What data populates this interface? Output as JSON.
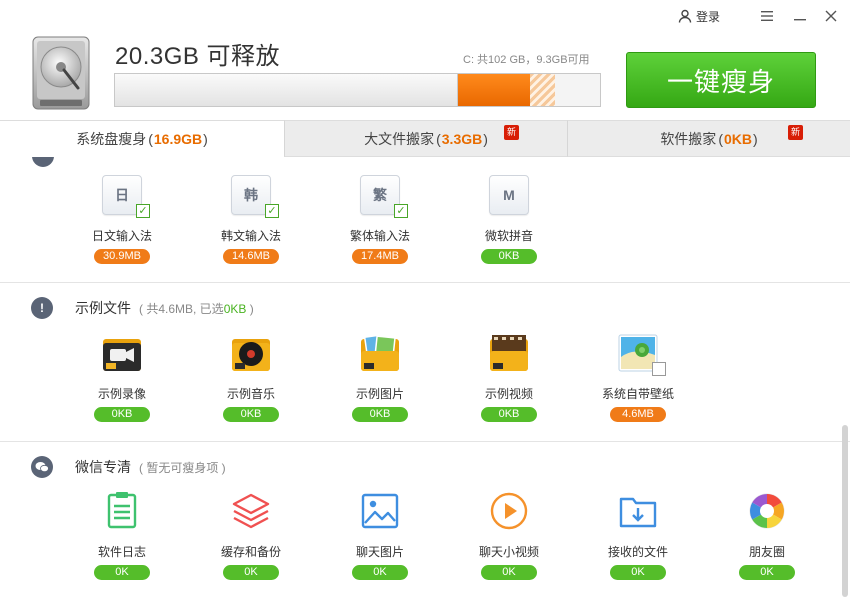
{
  "window": {
    "login_label": "登录",
    "menu_icon": "hamburger-icon",
    "minimize_icon": "minimize-icon",
    "close_icon": "close-icon"
  },
  "header": {
    "free_space_title": "20.3GB 可释放",
    "disk_info": "C: 共102 GB，9.3GB可用",
    "progress": {
      "used_fraction": 0.707,
      "freeable_fraction": 0.148,
      "pending_fraction": 0.052
    },
    "slim_button_label": "一键瘦身"
  },
  "tabs": [
    {
      "label": "系统盘瘦身",
      "size": "16.9GB",
      "active": true,
      "new": false
    },
    {
      "label": "大文件搬家",
      "size": "3.3GB",
      "active": false,
      "new": true,
      "badge": "新"
    },
    {
      "label": "软件搬家",
      "size": "0KB",
      "active": false,
      "new": true,
      "badge": "新"
    }
  ],
  "ime_section": {
    "items": [
      {
        "key": "日",
        "label": "日文输入法",
        "size": "30.9MB",
        "checked": true
      },
      {
        "key": "韩",
        "label": "韩文输入法",
        "size": "14.6MB",
        "checked": true
      },
      {
        "key": "繁",
        "label": "繁体输入法",
        "size": "17.4MB",
        "checked": true
      },
      {
        "key": "M",
        "label": "微软拼音",
        "size": "0KB",
        "checked": false
      }
    ]
  },
  "sample_section": {
    "title": "示例文件",
    "subtitle_prefix": "( 共4.6MB, 已选",
    "subtitle_selected": "0KB",
    "subtitle_suffix": " )",
    "items": [
      {
        "label": "示例录像",
        "size": "0KB"
      },
      {
        "label": "示例音乐",
        "size": "0KB"
      },
      {
        "label": "示例图片",
        "size": "0KB"
      },
      {
        "label": "示例视频",
        "size": "0KB"
      },
      {
        "label": "系统自带壁纸",
        "size": "4.6MB"
      }
    ]
  },
  "wechat_section": {
    "title": "微信专清",
    "subtitle": "( 暂无可瘦身项 )",
    "items": [
      {
        "label": "软件日志",
        "size": "0K"
      },
      {
        "label": "缓存和备份",
        "size": "0K"
      },
      {
        "label": "聊天图片",
        "size": "0K"
      },
      {
        "label": "聊天小视频",
        "size": "0K"
      },
      {
        "label": "接收的文件",
        "size": "0K"
      },
      {
        "label": "朋友圈",
        "size": "0K"
      }
    ]
  },
  "colors": {
    "accent_orange": "#e86c00",
    "green": "#55bd2a",
    "new_badge": "#d81e06"
  }
}
